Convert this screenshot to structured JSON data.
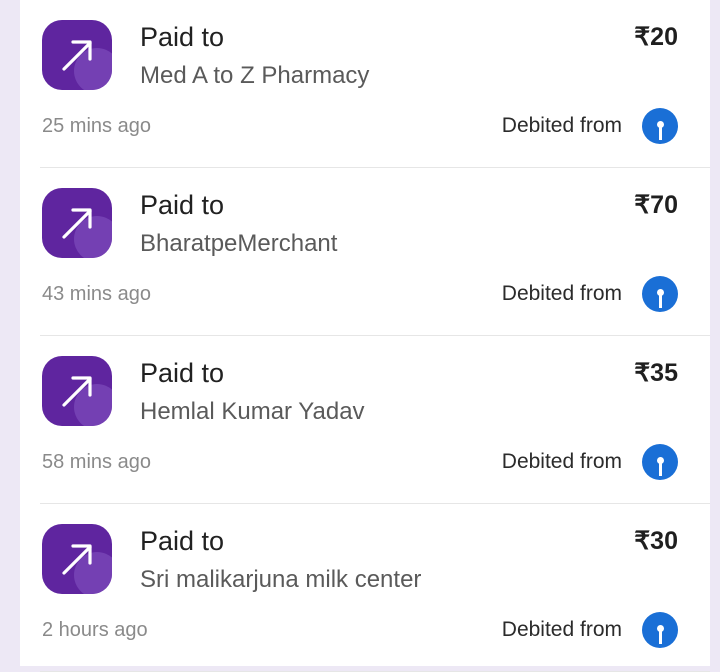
{
  "colors": {
    "brand": "#5f259f",
    "bank_icon": "#1a6fd6",
    "page_background": "#ede8f5"
  },
  "transactions": [
    {
      "title": "Paid to",
      "payee": "Med A to Z Pharmacy",
      "amount": "₹20",
      "time": "25 mins ago",
      "debit_label": "Debited from",
      "app_icon": "arrow-up-right-icon",
      "bank_icon": "bank-logo-icon"
    },
    {
      "title": "Paid to",
      "payee": "BharatpeMerchant",
      "amount": "₹70",
      "time": "43 mins ago",
      "debit_label": "Debited from",
      "app_icon": "arrow-up-right-icon",
      "bank_icon": "bank-logo-icon"
    },
    {
      "title": "Paid to",
      "payee": "Hemlal Kumar Yadav",
      "amount": "₹35",
      "time": "58 mins ago",
      "debit_label": "Debited from",
      "app_icon": "arrow-up-right-icon",
      "bank_icon": "bank-logo-icon"
    },
    {
      "title": "Paid to",
      "payee": "Sri malikarjuna milk center",
      "amount": "₹30",
      "time": "2 hours ago",
      "debit_label": "Debited from",
      "app_icon": "arrow-up-right-icon",
      "bank_icon": "bank-logo-icon"
    }
  ]
}
